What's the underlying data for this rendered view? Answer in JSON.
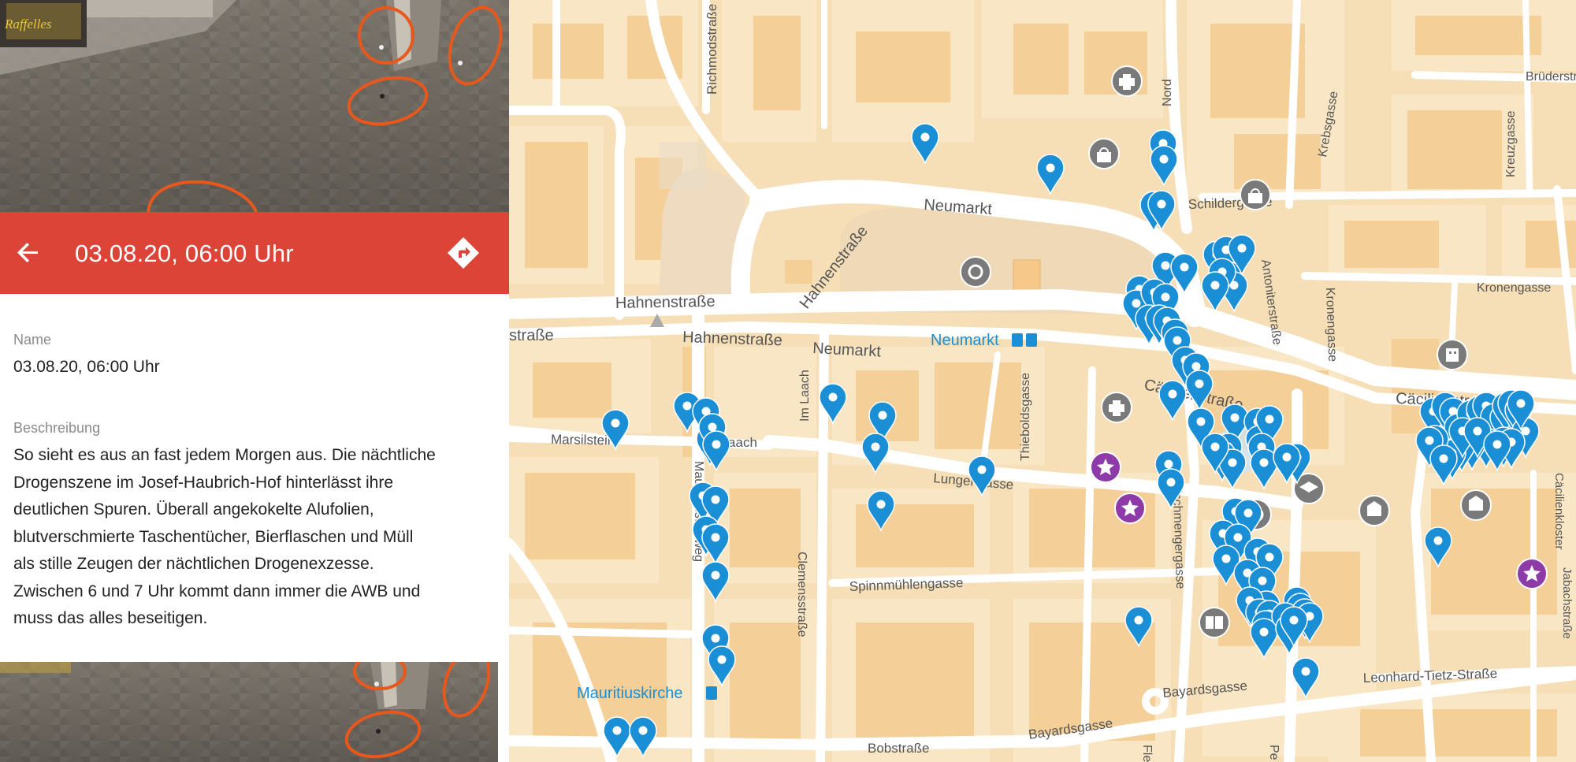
{
  "photo_sign": "Raffelles",
  "header": {
    "title": "03.08.20, 06:00 Uhr",
    "back_icon": "arrow-left-icon",
    "directions_icon": "directions-icon",
    "color": "#db4437"
  },
  "details": {
    "name_label": "Name",
    "name_value": "03.08.20, 06:00 Uhr",
    "description_label": "Beschreibung",
    "description_lines": [
      "So sieht es aus an fast jedem Morgen aus. Die nächtliche",
      "Drogenszene im Josef-Haubrich-Hof hinterlässt ihre",
      "deutlichen Spuren. Überall angekokelte Alufolien,",
      "blutverschmierte Taschentücher, Bierflaschen und Müll",
      "als stille Zeugen der nächtlichen Drogenexzesse.",
      "Zwischen 6 und 7 Uhr kommt dann immer die AWB und",
      "muss das alles beseitigen."
    ]
  },
  "map": {
    "marker_color": "#1a8fd6",
    "poi_color": "#7a7a7a",
    "favorite_color": "#8e3aa8",
    "streets": {
      "s1": "Richmodstraße",
      "s2": "Neumarkt",
      "s3": "Hahnenstraße",
      "s4": "Hahnenstraße",
      "s5": "Hahnenstraße",
      "s6": "Neumarkt",
      "s7": "Cäcilienstraße",
      "s8": "Cäcilienstraße",
      "s9": "Schildergasse",
      "s10": "Krebsgasse",
      "s11": "Kreuzgasse",
      "s12": "Kronengasse",
      "s13": "Kronengasse",
      "s14": "Marsilstein",
      "s15": "Im Laach",
      "s16": "Lungengasse",
      "s17": "Thieboldsgasse",
      "s18": "Spinnmühlengasse",
      "s19": "Clemensstraße",
      "s20": "Mauritiussteinweg",
      "s21": "Bayardsgasse",
      "s22": "Leonhard-Tietz-Straße",
      "s23": "Bobstraße",
      "s24": "Fleischmengergasse",
      "s25": "Antoniterstraße",
      "s26": "Brüderstraße",
      "s27": "Jabachstraße",
      "s28": "Cäcilienkloster",
      "s29": "straße",
      "s30": "Im Laach",
      "s31": "Nord",
      "s32": "Pe",
      "s33": "Fle"
    },
    "places": {
      "neumarkt_station": "Neumarkt",
      "mauritiuskirche": "Mauritiuskirche"
    }
  }
}
